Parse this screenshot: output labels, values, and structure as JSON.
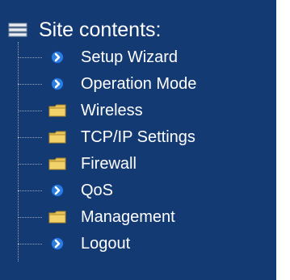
{
  "header": {
    "title": "Site contents:",
    "icon": "tree-root-icon"
  },
  "items": [
    {
      "label": "Setup Wizard",
      "icon": "arrow-icon"
    },
    {
      "label": "Operation Mode",
      "icon": "arrow-icon"
    },
    {
      "label": "Wireless",
      "icon": "folder-icon"
    },
    {
      "label": "TCP/IP Settings",
      "icon": "folder-icon"
    },
    {
      "label": "Firewall",
      "icon": "folder-icon"
    },
    {
      "label": "QoS",
      "icon": "arrow-icon"
    },
    {
      "label": "Management",
      "icon": "folder-icon"
    },
    {
      "label": "Logout",
      "icon": "arrow-icon"
    }
  ],
  "colors": {
    "background": "#143a74",
    "text": "#ffffff",
    "folder": "#f2d36b",
    "arrow_circle": "#2b7de0"
  }
}
